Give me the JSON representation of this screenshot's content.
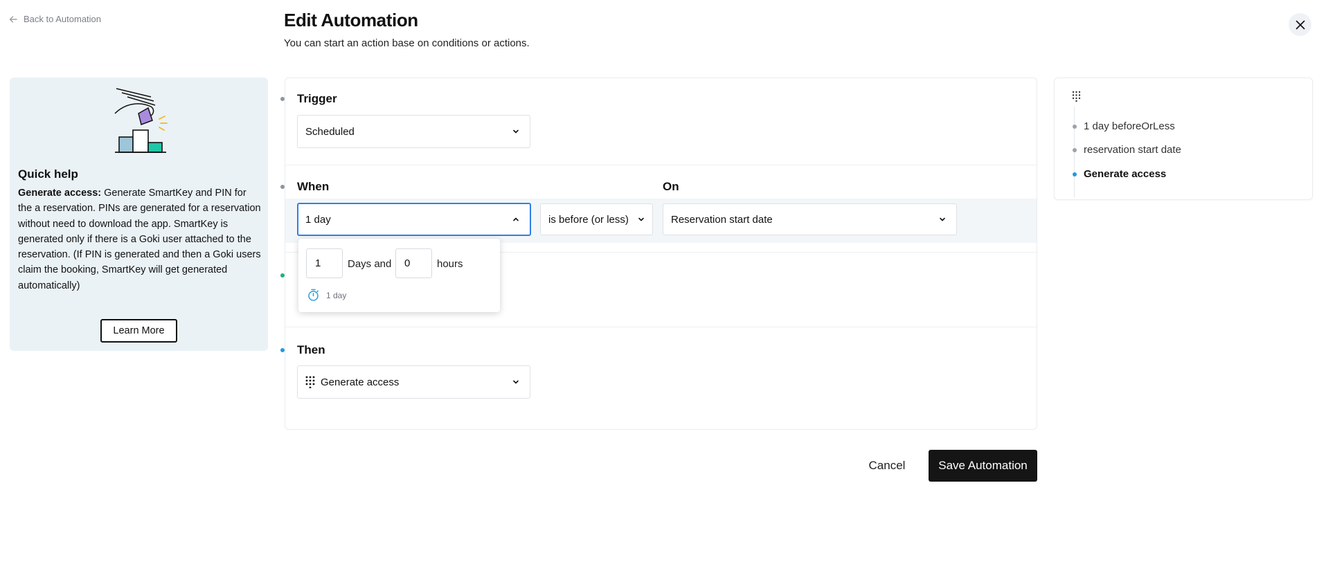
{
  "nav": {
    "back_label": "Back to Automation"
  },
  "header": {
    "title": "Edit Automation",
    "subtitle": "You can start an action base on conditions or actions."
  },
  "quick_help": {
    "title": "Quick help",
    "term": "Generate access:",
    "text": " Generate SmartKey and PIN for the a reservation. PINs are generated for a reservation without need to download the app. SmartKey is generated only if there is a Goki user attached to the reservation. (If PIN is generated and then a Goki users claim the booking, SmartKey will get generated automatically)",
    "learn_more_label": "Learn More"
  },
  "trigger": {
    "label": "Trigger",
    "value": "Scheduled"
  },
  "when": {
    "label": "When",
    "duration_value": "1 day",
    "condition_value": "is before (or less)",
    "on_label": "On",
    "on_value": "Reservation start date"
  },
  "duration_popup": {
    "days_value": "1",
    "days_label": "Days and",
    "hours_value": "0",
    "hours_label": "hours",
    "preview": "1 day"
  },
  "then": {
    "label": "Then",
    "value": "Generate access"
  },
  "footer": {
    "cancel_label": "Cancel",
    "save_label": "Save Automation"
  },
  "summary": {
    "items": [
      {
        "label": "1 day beforeOrLess"
      },
      {
        "label": "reservation start date"
      },
      {
        "label": "Generate access"
      }
    ]
  },
  "colors": {
    "accent": "#2f7fe8",
    "primary_button": "#151515",
    "help_background": "#eaf2f6",
    "dot_default": "#8c96a0",
    "dot_green": "#20b07a",
    "dot_blue": "#1e9be0"
  }
}
